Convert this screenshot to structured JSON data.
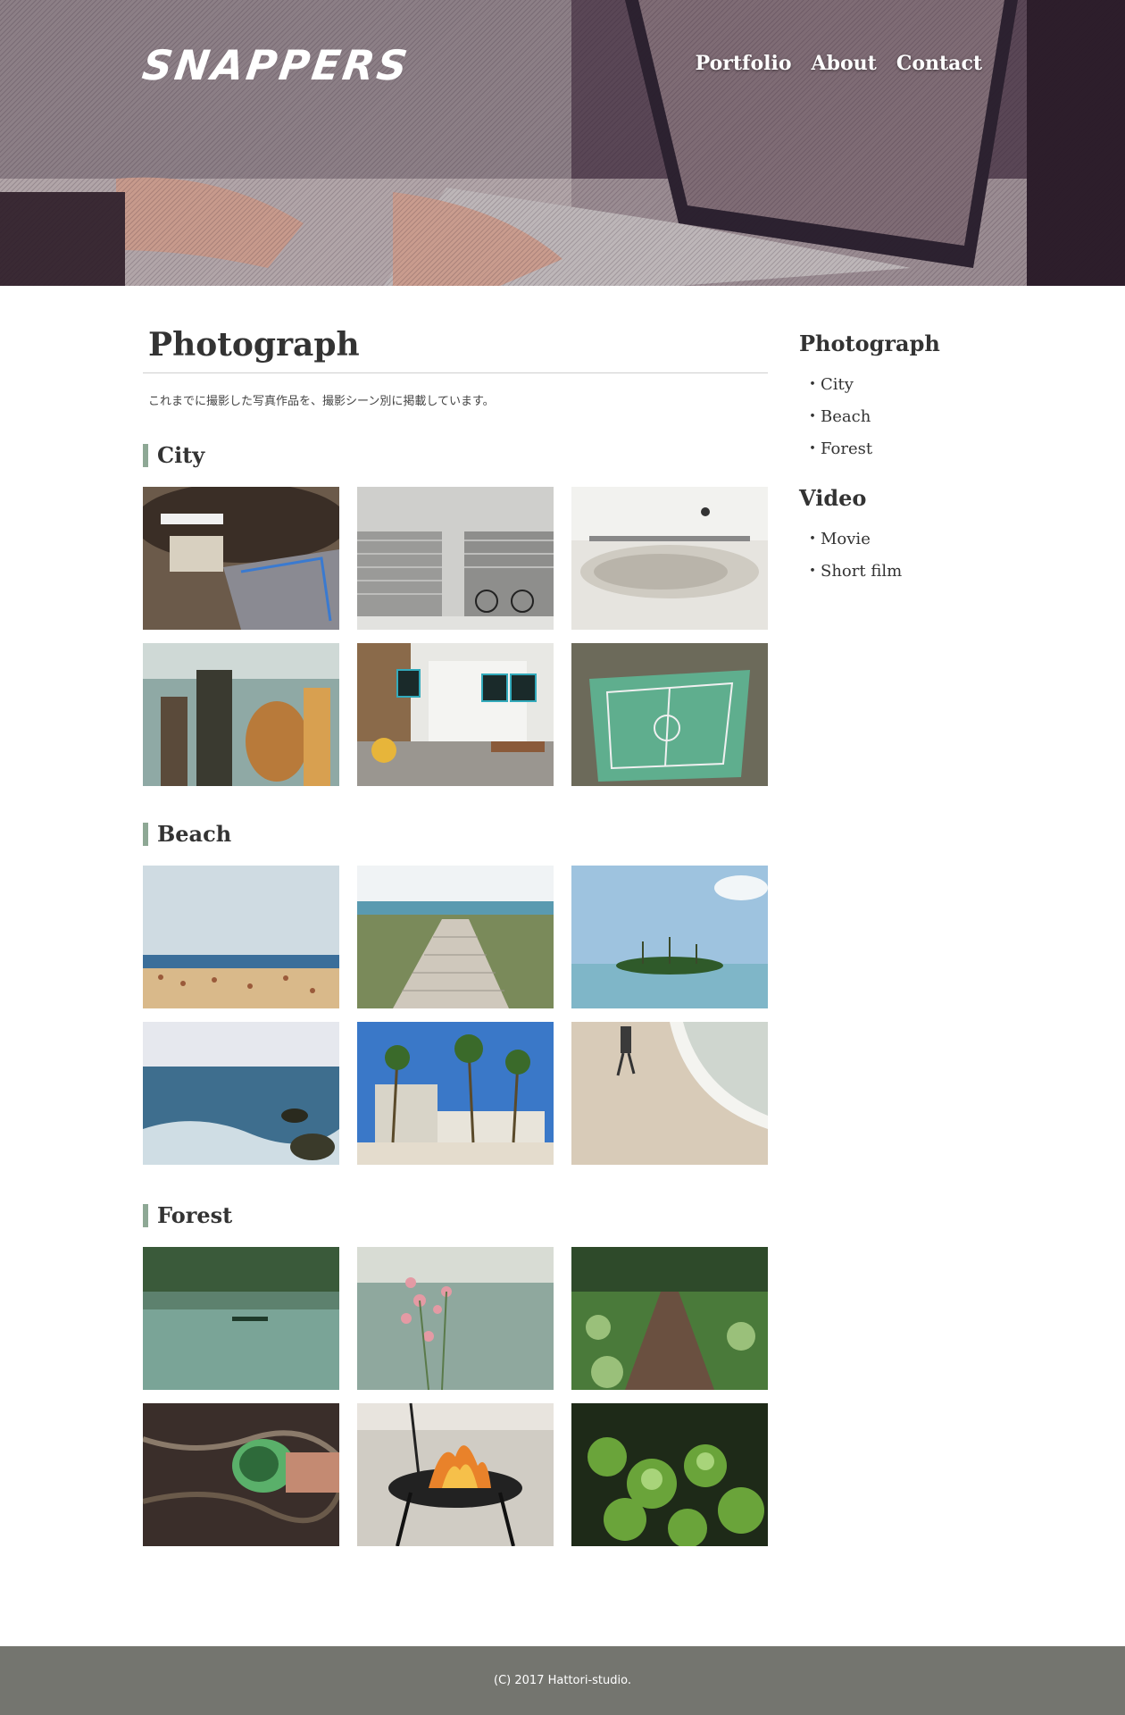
{
  "header": {
    "logo": "SNAPPERS",
    "nav": [
      {
        "label": "Portfolio"
      },
      {
        "label": "About"
      },
      {
        "label": "Contact"
      }
    ]
  },
  "main": {
    "title": "Photograph",
    "lead": "これまでに撮影した写真作品を、撮影シーン別に掲載しています。",
    "sections": [
      {
        "heading": "City"
      },
      {
        "heading": "Beach"
      },
      {
        "heading": "Forest"
      }
    ]
  },
  "sidebar": {
    "groups": [
      {
        "heading": "Photograph",
        "items": [
          {
            "label": "City"
          },
          {
            "label": "Beach"
          },
          {
            "label": "Forest"
          }
        ]
      },
      {
        "heading": "Video",
        "items": [
          {
            "label": "Movie"
          },
          {
            "label": "Short film"
          }
        ]
      }
    ]
  },
  "footer": {
    "copyright": "(C) 2017 Hattori-studio."
  }
}
